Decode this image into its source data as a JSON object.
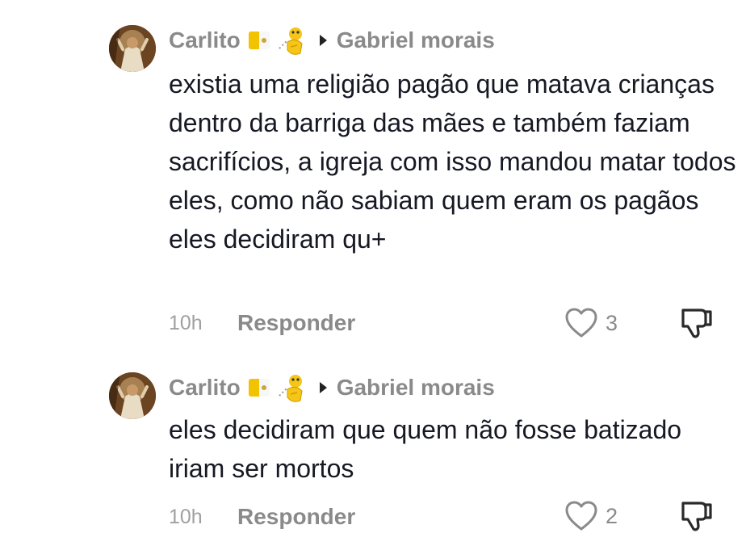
{
  "comments": [
    {
      "author": "Carlito",
      "author_badges": [
        "vatican-flag-icon",
        "pointing-emoji-icon"
      ],
      "reply_to": "Gabriel morais",
      "text": "existia uma religião pagão que matava crianças dentro da barriga das mães e também faziam sacrifícios, a igreja com isso mandou matar todos eles, como não sabiam quem eram os pagãos eles decidiram qu+",
      "time": "10h",
      "reply_label": "Responder",
      "likes": "3"
    },
    {
      "author": "Carlito",
      "author_badges": [
        "vatican-flag-icon",
        "pointing-emoji-icon"
      ],
      "reply_to": "Gabriel morais",
      "text": "eles decidiram que quem não fosse batizado iriam ser mortos",
      "time": "10h",
      "reply_label": "Responder",
      "likes": "2"
    }
  ],
  "colors": {
    "text_primary": "#161823",
    "text_secondary": "#8a8a8a",
    "background": "#ffffff"
  }
}
